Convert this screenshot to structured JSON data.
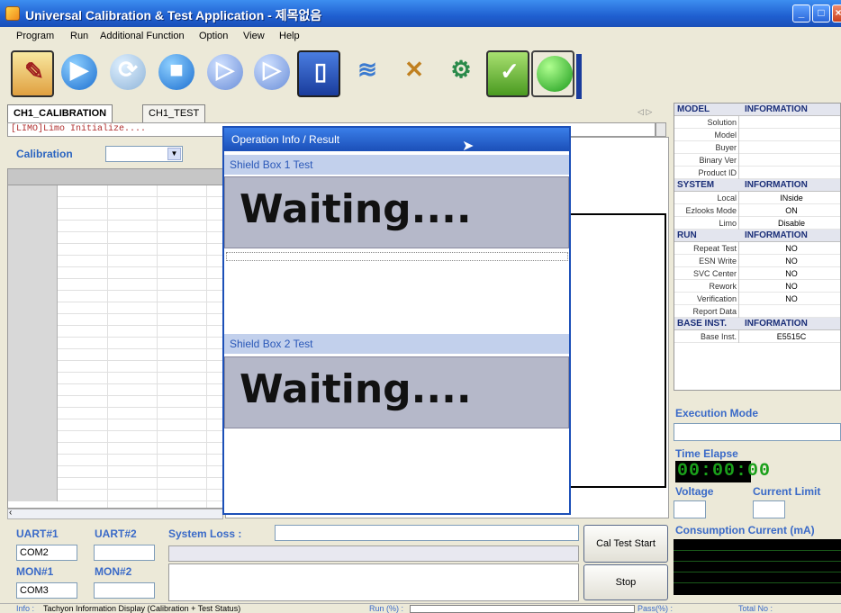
{
  "window": {
    "title": "Universal Calibration & Test Application - 제목없음"
  },
  "menu": [
    "Program",
    "Run",
    "Additional Function",
    "Option",
    "View",
    "Help"
  ],
  "toolbar": {
    "icons": [
      "calibration-tool-icon",
      "play-icon",
      "refresh-icon",
      "stop-icon",
      "step-icon",
      "next-icon",
      "phone-icon",
      "port-icon",
      "tools-icon",
      "gears-icon",
      "power-icon",
      "status-light-icon"
    ]
  },
  "tabs": [
    "CH1_CALIBRATION",
    "CH1_TEST"
  ],
  "log": "[LIMO]Limo Initialize....",
  "calibration": {
    "label": "Calibration",
    "selected": ""
  },
  "dialog": {
    "title": "Operation Info / Result",
    "box1": "Shield Box 1 Test",
    "box1_status": "Waiting....",
    "box2": "Shield Box 2 Test",
    "box2_status": "Waiting...."
  },
  "info": {
    "model": {
      "header": [
        "MODEL",
        "INFORMATION"
      ],
      "rows": [
        [
          "Solution",
          ""
        ],
        [
          "Model",
          ""
        ],
        [
          "Buyer",
          ""
        ],
        [
          "Binary Ver",
          ""
        ],
        [
          "Product ID",
          ""
        ]
      ]
    },
    "system": {
      "header": [
        "SYSTEM",
        "INFORMATION"
      ],
      "rows": [
        [
          "Local",
          "INside"
        ],
        [
          "Ezlooks Mode",
          "ON"
        ],
        [
          "Limo",
          "Disable"
        ]
      ]
    },
    "run": {
      "header": [
        "RUN",
        "INFORMATION"
      ],
      "rows": [
        [
          "Repeat Test",
          "NO"
        ],
        [
          "ESN Write",
          "NO"
        ],
        [
          "SVC Center",
          "NO"
        ],
        [
          "Rework",
          "NO"
        ],
        [
          "Verification",
          "NO"
        ],
        [
          "Report Data",
          ""
        ]
      ]
    },
    "base": {
      "header": [
        "BASE INST.",
        "INFORMATION"
      ],
      "rows": [
        [
          "Base Inst.",
          "E5515C"
        ]
      ]
    }
  },
  "right": {
    "execution_mode": "Execution Mode",
    "time_elapse": "Time Elapse",
    "time_value": "00:00:00",
    "voltage": "Voltage",
    "current_limit": "Current Limit",
    "consumption": "Consumption Current (mA)"
  },
  "bottom": {
    "uart1": "UART#1",
    "uart2": "UART#2",
    "uart1_value": "COM2",
    "system_loss": "System Loss :",
    "mon1": "MON#1",
    "mon2": "MON#2",
    "mon1_value": "COM3",
    "cal_test_start": "Cal Test Start",
    "stop": "Stop"
  },
  "statusbar": {
    "info_label": "Info :",
    "info_text": "Tachyon Information Display (Calibration + Test Status)",
    "run_label": "Run (%) :",
    "pass_label": "Pass(%) :",
    "total_label": "Total No :"
  }
}
